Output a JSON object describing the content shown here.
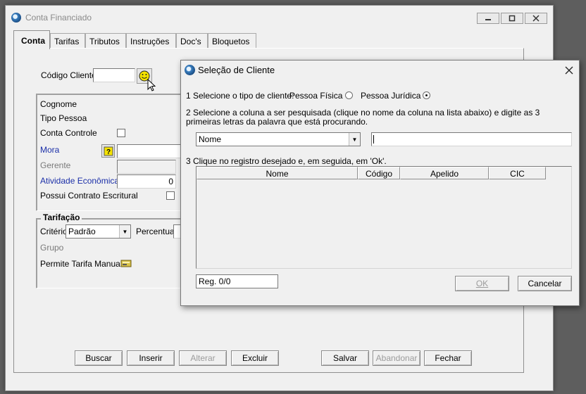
{
  "window": {
    "title": "Conta Financiado"
  },
  "tabs": [
    "Conta",
    "Tarifas",
    "Tributos",
    "Instruções",
    "Doc's",
    "Bloquetos"
  ],
  "form": {
    "codigo_cliente_label": "Código Cliente",
    "codigo_cliente_value": "",
    "cognome_label": "Cognome",
    "tipo_pessoa_label": "Tipo Pessoa",
    "conta_controle_label": "Conta Controle",
    "mora_label": "Mora",
    "gerente_label": "Gerente",
    "atividade_label": "Atividade Econômica",
    "atividade_value": "0",
    "contrato_label": "Possui Contrato Escritural"
  },
  "tarifacao": {
    "title": "Tarifação",
    "criterio_label": "Critério",
    "criterio_value": "Padrão",
    "percentual_label": "Percentual",
    "grupo_label": "Grupo",
    "tarifa_manual_label": "Permite Tarifa Manual"
  },
  "bottom_buttons": [
    {
      "label": "Buscar",
      "enabled": true
    },
    {
      "label": "Inserir",
      "enabled": true
    },
    {
      "label": "Alterar",
      "enabled": false
    },
    {
      "label": "Excluir",
      "enabled": true
    },
    {
      "label": "Salvar",
      "enabled": true
    },
    {
      "label": "Abandonar",
      "enabled": false
    },
    {
      "label": "Fechar",
      "enabled": true
    }
  ],
  "dialog": {
    "title": "Seleção de Cliente",
    "step1": "1  Selecione o tipo de cliente:",
    "opt_fisica": "Pessoa Física",
    "opt_juridica": "Pessoa Jurídica",
    "selected_option": "Pessoa Jurídica",
    "step2": "2  Selecione a coluna a ser pesquisada (clique no nome da coluna na lista abaixo) e digite as 3 primeiras  letras da palavra que está procurando.",
    "column_select_value": "Nome",
    "search_value": "",
    "step3": "3  Clique no registro desejado e, em seguida, em 'Ok'.",
    "columns": [
      "Nome",
      "Código",
      "Apelido",
      "CIC"
    ],
    "rows": [],
    "record_status": "Reg. 0/0",
    "ok_label": "OK",
    "cancel_label": "Cancelar"
  }
}
